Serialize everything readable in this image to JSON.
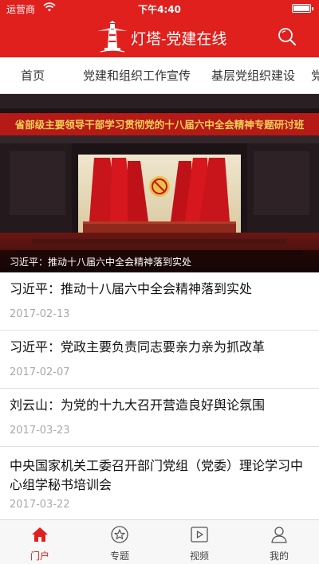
{
  "status_bar": {
    "carrier": "运营商",
    "time": "下午4:40"
  },
  "app": {
    "title": "灯塔-党建在线"
  },
  "tabs": [
    {
      "label": "首页"
    },
    {
      "label": "党建和组织工作宣传"
    },
    {
      "label": "基层党组织建设"
    },
    {
      "label": "党"
    }
  ],
  "banner": {
    "backdrop_text": "省部级主要领导干部学习贯彻党的十八届六中全会精神专题研讨班",
    "caption": "习近平：推动十八届六中全会精神落到实处",
    "slides": 4,
    "active_slide": 1
  },
  "news": [
    {
      "title": "习近平：推动十八届六中全会精神落到实处",
      "date": "2017-02-13"
    },
    {
      "title": "习近平：党政主要负责同志要亲力亲为抓改革",
      "date": "2017-02-07"
    },
    {
      "title": "刘云山：为党的十九大召开营造良好舆论氛围",
      "date": "2017-03-23"
    },
    {
      "title": "中央国家机关工委召开部门党组（党委）理论学习中心组学秘书培训会",
      "date": "2017-03-22"
    }
  ],
  "bottom_nav": [
    {
      "label": "门户",
      "icon": "home-icon"
    },
    {
      "label": "专题",
      "icon": "star-icon"
    },
    {
      "label": "视频",
      "icon": "play-icon"
    },
    {
      "label": "我的",
      "icon": "user-icon"
    }
  ],
  "colors": {
    "brand": "#e0201d",
    "date": "#a9a9a9"
  }
}
